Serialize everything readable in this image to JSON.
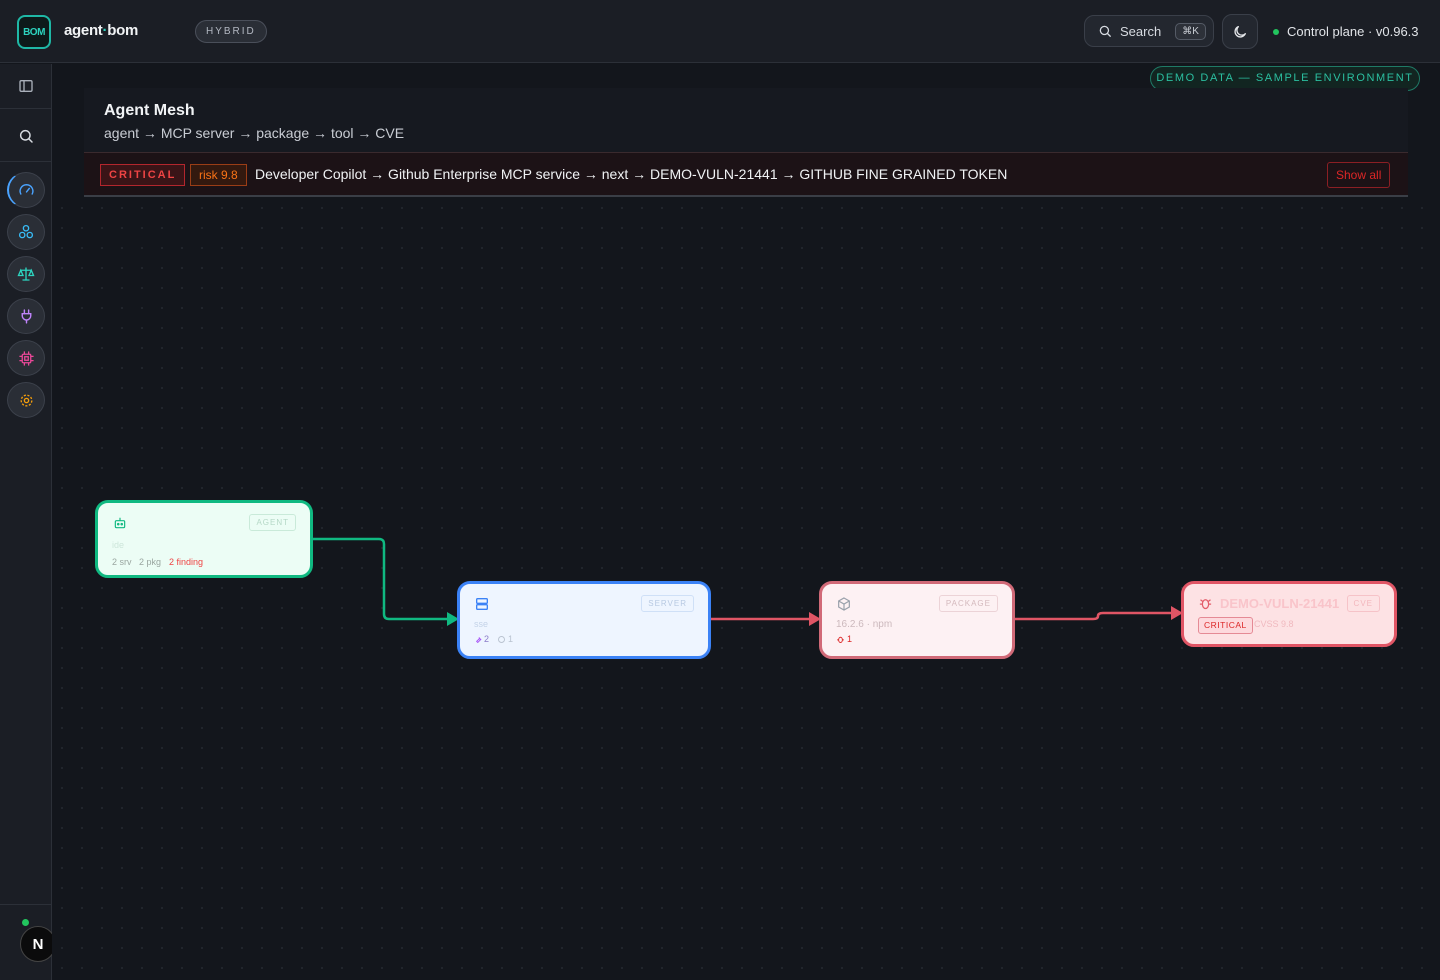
{
  "topbar": {
    "logo_text": "BOM",
    "brand": "agent",
    "brand_dot": "·",
    "brand_suffix": "bom",
    "mode_badge": "HYBRID",
    "search_label": "Search",
    "search_shortcut": "⌘K",
    "control_plane": "Control plane · v0.96.3"
  },
  "sidebar": {
    "items": [
      {
        "name": "panel-toggle",
        "icon": "sidebar-icon"
      },
      {
        "name": "search",
        "icon": "search-icon"
      },
      {
        "name": "dashboard",
        "icon": "gauge-icon",
        "color": "#4aa3ff"
      },
      {
        "name": "mesh",
        "icon": "network-icon",
        "color": "#38bdf8"
      },
      {
        "name": "compliance",
        "icon": "scale-icon",
        "color": "#2dd4bf"
      },
      {
        "name": "integrations",
        "icon": "plug-icon",
        "color": "#c084fc"
      },
      {
        "name": "hardware",
        "icon": "chip-icon",
        "color": "#ec4899"
      },
      {
        "name": "settings",
        "icon": "gear-icon",
        "color": "#f59e0b"
      }
    ],
    "user_initial": "N"
  },
  "demo_badge": "DEMO DATA — SAMPLE ENVIRONMENT",
  "page": {
    "title": "Agent Mesh",
    "subtitle": "agent → MCP server → package → tool → CVE"
  },
  "alert": {
    "severity": "CRITICAL",
    "risk": "risk 9.8",
    "path": "Developer Copilot → Github Enterprise MCP service → next → DEMO-VULN-21441 → GITHUB FINE GRAINED TOKEN",
    "show_all": "Show all"
  },
  "graph": {
    "agent": {
      "type": "AGENT",
      "name": "",
      "kind": "ide",
      "srv": "2 srv",
      "pkg": "2 pkg",
      "findings": "2 finding"
    },
    "server": {
      "type": "SERVER",
      "name": "",
      "transport": "sse",
      "tools": "2",
      "resources": "1"
    },
    "package": {
      "type": "PACKAGE",
      "name": "",
      "version": "16.2.6 · npm",
      "vulns": "1"
    },
    "cve": {
      "type": "CVE",
      "name": "DEMO-VULN-21441",
      "severity": "CRITICAL",
      "cvss": "CVSS 9.8"
    },
    "colors": {
      "agent": "#10b981",
      "server": "#3b82f6",
      "danger": "#e05565"
    }
  }
}
